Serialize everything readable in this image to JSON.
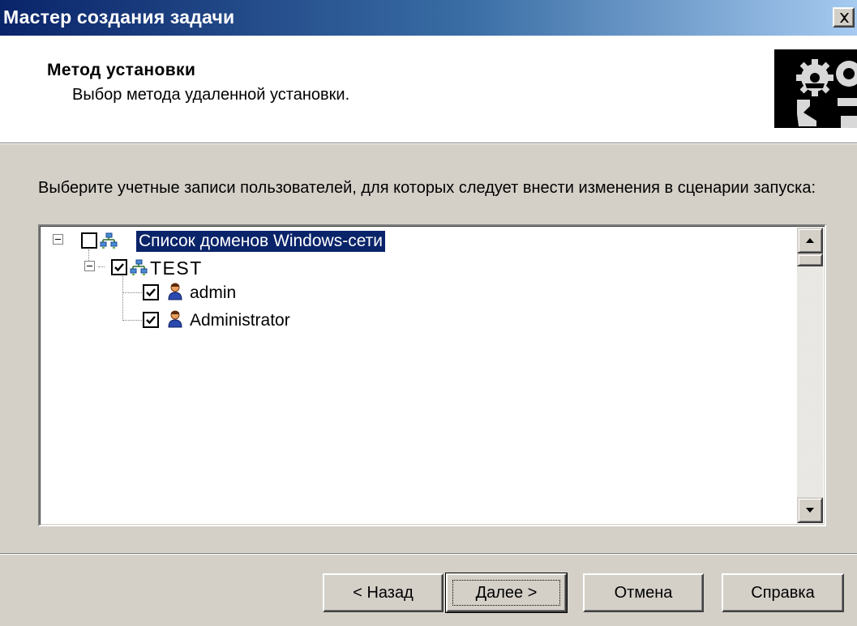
{
  "window": {
    "title": "Мастер создания задачи",
    "close_icon": "close-icon"
  },
  "header": {
    "title": "Метод установки",
    "subtitle": "Выбор метода удаленной установки.",
    "art_icon": "gears-icon"
  },
  "main": {
    "instruction": "Выберите учетные записи пользователей, для которых следует внести изменения в сценарии запуска:"
  },
  "tree": {
    "root": {
      "label": "Список доменов Windows-сети",
      "checked": false,
      "expanded": true,
      "selected": true,
      "icon": "network-icon"
    },
    "domain": {
      "label": "TEST",
      "checked": true,
      "expanded": true,
      "icon": "network-icon"
    },
    "users": [
      {
        "label": "admin",
        "checked": true,
        "icon": "user-icon"
      },
      {
        "label": "Administrator",
        "checked": true,
        "icon": "user-icon"
      }
    ]
  },
  "buttons": {
    "back": "< Назад",
    "next": "Далее >",
    "cancel": "Отмена",
    "help": "Справка"
  },
  "colors": {
    "titlebar_start": "#0a246a",
    "titlebar_end": "#a6caf0",
    "face": "#d4d0c8",
    "selection": "#0a246a"
  }
}
